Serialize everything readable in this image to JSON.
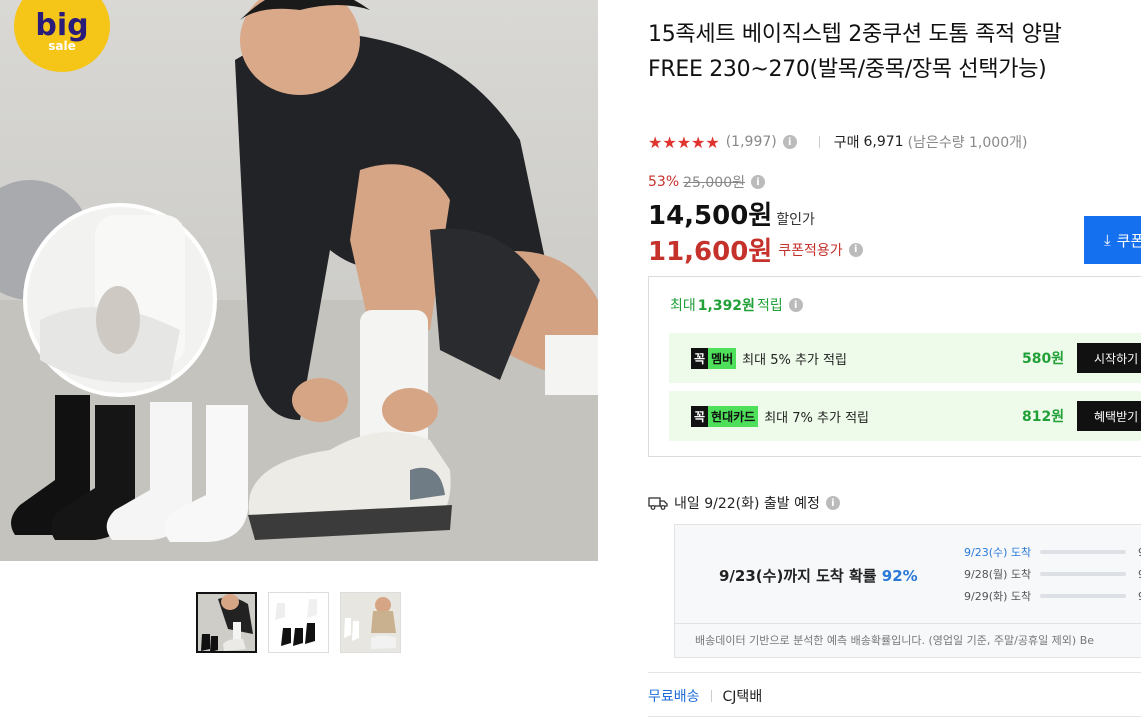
{
  "badge": {
    "big": "big",
    "sale": "sale"
  },
  "product": {
    "title": "15족세트 베이직스텝 2중쿠션 도톰 족적 양말 FREE 230~270(발목/중목/장목 선택가능)",
    "rating_stars": "★★★★★",
    "rating_value": 4.5,
    "review_count": "(1,997)",
    "buy_label": "구매",
    "buy_count": "6,971",
    "remain": "(남은수량 1,000개)",
    "discount_rate": "53%",
    "original_price": "25,000원",
    "price": "14,500원",
    "price_label": "할인가",
    "coupon_price": "11,600원",
    "coupon_label": "쿠폰적용가",
    "coupon_button": "쿠폰"
  },
  "rewards": {
    "header_prefix": "최대",
    "header_amount": "1,392원",
    "header_suffix": "적립",
    "items": [
      {
        "tag1": "꼭",
        "tag2": "멤버",
        "desc": "최대 5% 추가 적립",
        "amount": "580원",
        "button": "시작하기"
      },
      {
        "tag1": "꼭",
        "tag2": "현대카드",
        "desc": "최대 7% 추가 적립",
        "amount": "812원",
        "button": "혜택받기"
      }
    ]
  },
  "shipping": {
    "depart": "내일 9/22(화) 출발 예정",
    "prob_prefix": "9/23(수)까지 도착 확률",
    "prob_value": "92%",
    "lines": [
      {
        "day": "9/23(수) 도착",
        "fraction": 0.92,
        "tail": "9"
      },
      {
        "day": "9/28(월) 도착",
        "fraction": 0.0,
        "tail": "9"
      },
      {
        "day": "9/29(화) 도착",
        "fraction": 0.0,
        "tail": "9"
      }
    ],
    "note": "배송데이터 기반으로 분석한 예측 배송확률입니다. (영업일 기준, 주말/공휴일 제외) Be",
    "free_ship": "무료배송",
    "courier": "CJ택배"
  },
  "colors": {
    "accent_blue": "#1570f0",
    "sale_red": "#c5312b",
    "reward_green": "#21a038",
    "star_red": "#e0342f"
  }
}
